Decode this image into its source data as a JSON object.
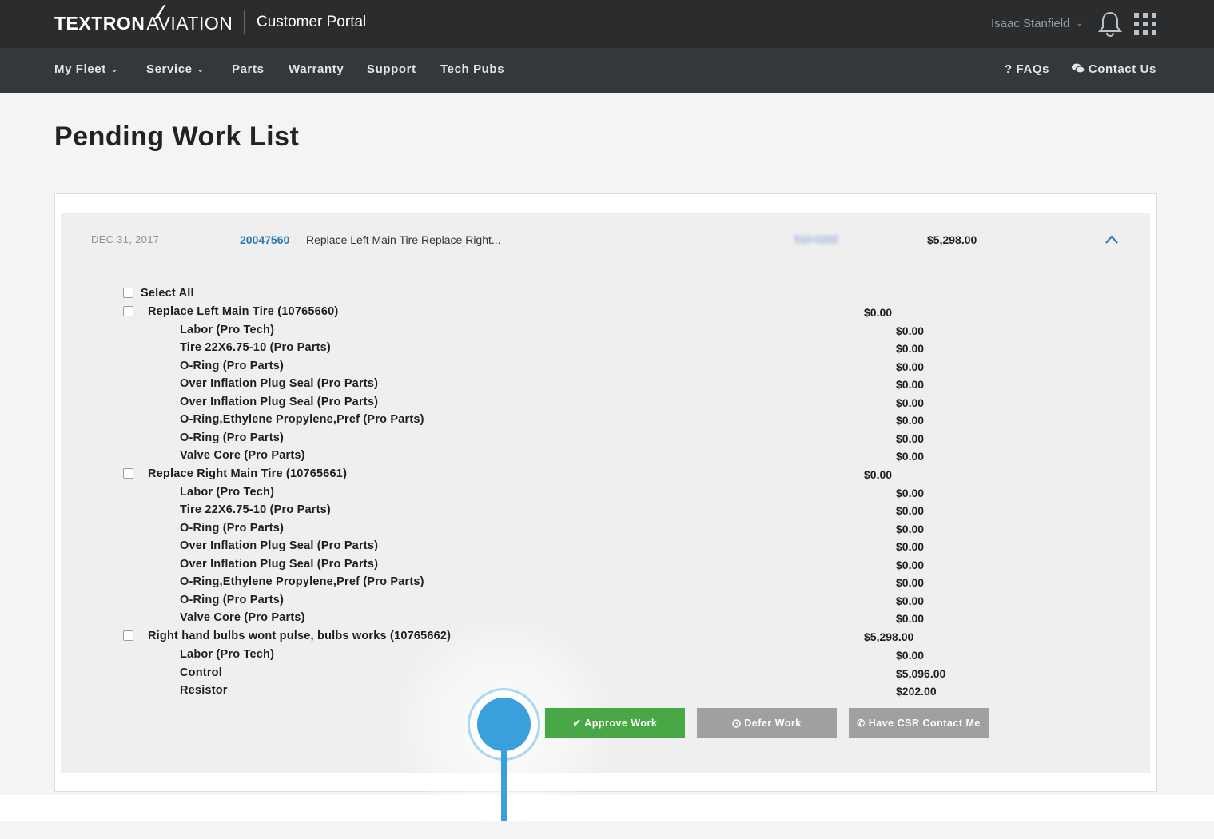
{
  "header": {
    "logo_brand": "TEXTRON",
    "logo_sub": "AVIATION",
    "portal_title": "Customer Portal",
    "user_name": "Isaac Stanfield",
    "user_chevron": "⌄",
    "icons": [
      "bell-icon",
      "apps-grid-icon"
    ]
  },
  "nav": {
    "my_fleet": "My Fleet",
    "service": "Service",
    "parts": "Parts",
    "warranty": "Warranty",
    "support": "Support",
    "tech_pubs": "Tech Pubs",
    "faqs": "FAQs",
    "contact_us": "Contact Us"
  },
  "page": {
    "title": "Pending Work List"
  },
  "work_order": {
    "date": "DEC 31, 2017",
    "number": "20047560",
    "description": "Replace Left Main Tire Replace Right...",
    "tail_number_blurred": "510-0292",
    "total": "$5,298.00"
  },
  "select_all_label": "Select All",
  "items": [
    {
      "label": "Replace Left Main Tire (10765660)",
      "amount": "$0.00",
      "lines": [
        {
          "label": "Labor  (Pro Tech)",
          "amount": "$0.00"
        },
        {
          "label": "Tire 22X6.75-10  (Pro Parts)",
          "amount": "$0.00"
        },
        {
          "label": "O-Ring  (Pro Parts)",
          "amount": "$0.00"
        },
        {
          "label": "Over Inflation Plug Seal  (Pro Parts)",
          "amount": "$0.00"
        },
        {
          "label": "Over Inflation Plug Seal  (Pro Parts)",
          "amount": "$0.00"
        },
        {
          "label": "O-Ring,Ethylene Propylene,Pref  (Pro Parts)",
          "amount": "$0.00"
        },
        {
          "label": "O-Ring  (Pro Parts)",
          "amount": "$0.00"
        },
        {
          "label": "Valve Core  (Pro Parts)",
          "amount": "$0.00"
        }
      ]
    },
    {
      "label": "Replace Right Main Tire (10765661)",
      "amount": "$0.00",
      "lines": [
        {
          "label": "Labor  (Pro Tech)",
          "amount": "$0.00"
        },
        {
          "label": "Tire 22X6.75-10  (Pro Parts)",
          "amount": "$0.00"
        },
        {
          "label": "O-Ring  (Pro Parts)",
          "amount": "$0.00"
        },
        {
          "label": "Over Inflation Plug Seal  (Pro Parts)",
          "amount": "$0.00"
        },
        {
          "label": "Over Inflation Plug Seal  (Pro Parts)",
          "amount": "$0.00"
        },
        {
          "label": "O-Ring,Ethylene Propylene,Pref  (Pro Parts)",
          "amount": "$0.00"
        },
        {
          "label": "O-Ring  (Pro Parts)",
          "amount": "$0.00"
        },
        {
          "label": "Valve Core  (Pro Parts)",
          "amount": "$0.00"
        }
      ]
    },
    {
      "label": "Right hand bulbs wont pulse, bulbs works (10765662)",
      "amount": "$5,298.00",
      "lines": [
        {
          "label": "Labor  (Pro Tech)",
          "amount": "$0.00"
        },
        {
          "label": "Control",
          "amount": "$5,096.00"
        },
        {
          "label": "Resistor",
          "amount": "$202.00"
        }
      ]
    }
  ],
  "actions": {
    "approve": "Approve Work",
    "defer": "Defer Work",
    "csr": "Have CSR Contact Me"
  },
  "colors": {
    "topbar": "#2a2c2e",
    "navbar": "#35383b",
    "link_blue": "#2a7ab8",
    "approve_green": "#48a846",
    "secondary_gray": "#a0a0a0",
    "click_marker": "#3a9fdd"
  }
}
